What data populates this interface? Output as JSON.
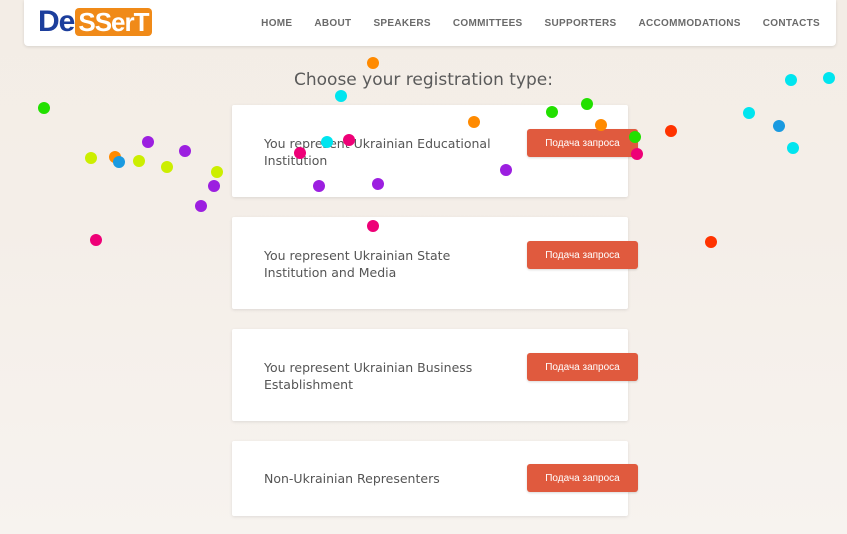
{
  "header": {
    "logo_part1": "De",
    "logo_part2": "SSerT",
    "nav": [
      "HOME",
      "ABOUT",
      "SPEAKERS",
      "COMMITTEES",
      "SUPPORTERS",
      "ACCOMMODATIONS",
      "CONTACTS"
    ]
  },
  "page": {
    "title": "Choose your registration type:"
  },
  "options": [
    {
      "label": "You represent Ukrainian Educational Institution",
      "button": "Подача запроса"
    },
    {
      "label": "You represent Ukrainian State Institution and Media",
      "button": "Подача запроса"
    },
    {
      "label": "You represent Ukrainian Business Establishment",
      "button": "Подача запроса"
    },
    {
      "label": "Non-Ukrainian Representers",
      "button": "Подача запроса"
    }
  ],
  "colors": {
    "logo_blue": "#1c3e9c",
    "logo_orange": "#f08a18",
    "button": "#e05a3e",
    "dots": [
      "#22e000",
      "#00e5ef",
      "#ff8a00",
      "#9c1fe0",
      "#ee0077",
      "#ccee00",
      "#1a9ae0",
      "#ff3300"
    ]
  }
}
